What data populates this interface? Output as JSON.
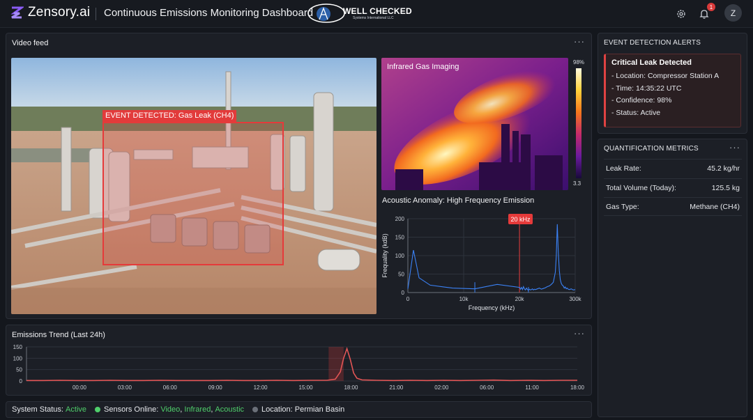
{
  "header": {
    "brand": "Zensory.ai",
    "title": "Continuous Emissions Monitoring Dashboard",
    "partner": {
      "name": "WELL CHECKED",
      "tagline": "Systems International LLC"
    },
    "notification_count": "1",
    "avatar_initial": "Z",
    "icons": [
      "settings-gear-icon",
      "bell-icon"
    ]
  },
  "video_panel": {
    "title": "Video feed",
    "more": "···",
    "detection_label": "EVENT DETECTED: Gas Leak (CH4)",
    "infrared": {
      "title": "Infrared Gas Imaging",
      "scale_max": "98%",
      "scale_min": "3.3"
    },
    "acoustic": {
      "title": "Acoustic Anomaly: High Frequency Emission",
      "peak_label": "20 kHz"
    }
  },
  "trend_panel": {
    "title": "Emissions Trend (Last 24h)",
    "more": "···"
  },
  "alerts_panel": {
    "title": "EVENT DETECTION ALERTS",
    "alert": {
      "title": "Critical Leak Detected",
      "location_label": "Location:",
      "location": "Compressor Station A",
      "time_label": "Time:",
      "time": "14:35:22 UTC",
      "confidence_label": "Confidence:",
      "confidence": "98%",
      "status_label": "Status:",
      "status": "Active"
    },
    "accent": "#e04242"
  },
  "metrics_panel": {
    "title": "QUANTIFICATION METRICS",
    "more": "···",
    "rows": [
      {
        "label": "Leak Rate:",
        "value": "45.2 kg/hr"
      },
      {
        "label": "Total Volume (Today):",
        "value": "125.5 kg"
      },
      {
        "label": "Gas Type:",
        "value": "Methane (CH4)"
      }
    ]
  },
  "status_bar": {
    "system_label": "System Status:",
    "system_value": "Active",
    "sensors_label": "Sensors Online:",
    "sensors": [
      "Video",
      "Infrared",
      "Acoustic"
    ],
    "location_label": "Location:",
    "location": "Permian Basin",
    "ok_color": "#4fce6b"
  },
  "chart_data": [
    {
      "type": "line",
      "title": "Acoustic Anomaly: High Frequency Emission",
      "xlabel": "Frequency (kHz)",
      "ylabel": "Frequality (kdB)",
      "xlim": [
        0,
        300
      ],
      "ylim": [
        0,
        200
      ],
      "x_ticks": [
        "0",
        "10k",
        "20k",
        "300k"
      ],
      "y_ticks": [
        "0",
        "50",
        "100",
        "150",
        "200"
      ],
      "grid": true,
      "annotation": "20 kHz",
      "series": [
        {
          "color": "#3b82f6",
          "x": [
            0,
            1,
            2,
            4,
            8,
            12,
            16,
            20,
            25,
            30,
            35,
            40,
            45,
            50,
            55,
            60,
            65,
            70,
            75,
            80,
            85,
            90,
            95,
            100,
            110,
            120,
            130,
            140,
            150,
            160,
            170,
            180,
            190,
            200,
            205,
            210,
            215,
            220,
            225,
            230,
            235,
            240,
            245,
            250,
            255,
            260,
            265,
            270,
            280,
            290,
            300
          ],
          "y": [
            10,
            115,
            40,
            20,
            12,
            10,
            22,
            14,
            9,
            14,
            8,
            16,
            10,
            7,
            12,
            8,
            6,
            9,
            7,
            8,
            10,
            7,
            9,
            8,
            10,
            12,
            9,
            11,
            13,
            16,
            18,
            22,
            28,
            55,
            100,
            185,
            110,
            60,
            35,
            25,
            20,
            18,
            12,
            15,
            10,
            12,
            9,
            8,
            10,
            7,
            8
          ]
        }
      ],
      "spikes": [
        {
          "x": 12,
          "y": 28
        },
        {
          "x": 65,
          "y": 15
        }
      ]
    },
    {
      "type": "line",
      "title": "Emissions Trend (Last 24h)",
      "xlabel": "",
      "ylabel": "",
      "ylim": [
        0,
        150
      ],
      "x_ticks": [
        "00:00",
        "03:00",
        "06:00",
        "09:00",
        "12:00",
        "15:00",
        "18:00",
        "21:00",
        "02:00",
        "06:00",
        "11:00",
        "18:00"
      ],
      "y_ticks": [
        "0",
        "50",
        "100",
        "150"
      ],
      "grid": true,
      "series": [
        {
          "color": "#e25555",
          "x": [
            0,
            1,
            2,
            3,
            4,
            5,
            6,
            7,
            8,
            9,
            10,
            11,
            12,
            13,
            14,
            15,
            16,
            17,
            18,
            18.5,
            18.8,
            19.0,
            19.2,
            19.4,
            19.6,
            19.8,
            20.1,
            20.5,
            21,
            22,
            23,
            24,
            25,
            26,
            27,
            28,
            29,
            30,
            31,
            32,
            33
          ],
          "y": [
            2,
            2,
            3,
            2,
            2,
            3,
            2,
            2,
            3,
            2,
            2,
            2,
            3,
            2,
            2,
            3,
            2,
            3,
            3,
            8,
            40,
            100,
            142,
            95,
            35,
            12,
            5,
            4,
            3,
            2,
            3,
            2,
            3,
            2,
            3,
            4,
            2,
            3,
            2,
            3,
            3
          ]
        }
      ],
      "highlight_range": [
        18.1,
        19.0
      ]
    }
  ]
}
